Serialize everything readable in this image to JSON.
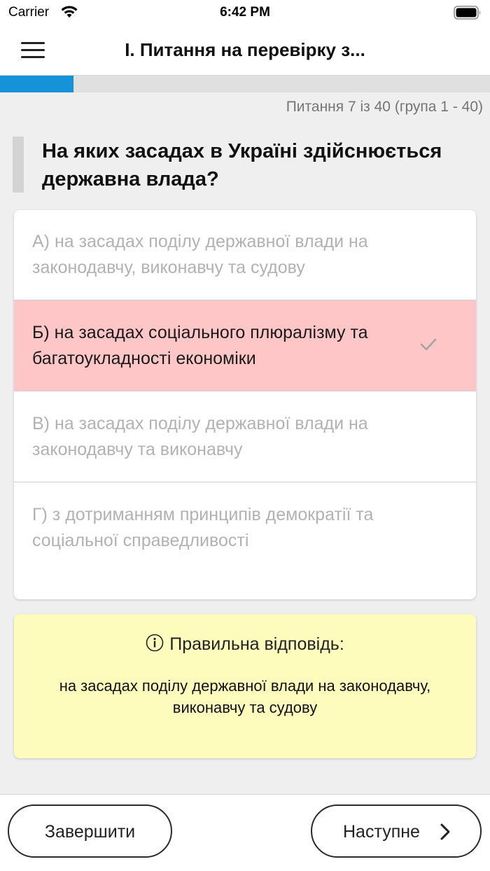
{
  "status_bar": {
    "carrier": "Carrier",
    "time": "6:42 PM"
  },
  "nav": {
    "title": "I. Питання на перевірку з..."
  },
  "progress": {
    "current": 7,
    "total": 40,
    "fraction": 0.15,
    "accent_color": "#1592d8"
  },
  "counter": "Питання 7 із 40 (група 1 - 40)",
  "question": "На яких засадах в Україні здійснюється державна влада?",
  "answers": [
    {
      "label": "А) на засадах поділу державної влади на законодавчу, виконавчу та судову",
      "selected": false
    },
    {
      "label": "Б) на засадах соціального плюралізму та багатоукладності економіки",
      "selected": true
    },
    {
      "label": "В) на засадах поділу державної влади на законодавчу та виконавчу",
      "selected": false
    },
    {
      "label": "Г) з дотриманням принципів демократії та соціальної справедливості",
      "selected": false
    }
  ],
  "selected_color": "#fec6c6",
  "correct": {
    "heading": "Правильна відповідь:",
    "text": "на засадах поділу державної влади на законодавчу, виконавчу та судову",
    "background": "#fdfcbd",
    "icon": "info-icon"
  },
  "buttons": {
    "finish": "Завершити",
    "next": "Наступне",
    "next_icon": "chevron-right-icon"
  }
}
